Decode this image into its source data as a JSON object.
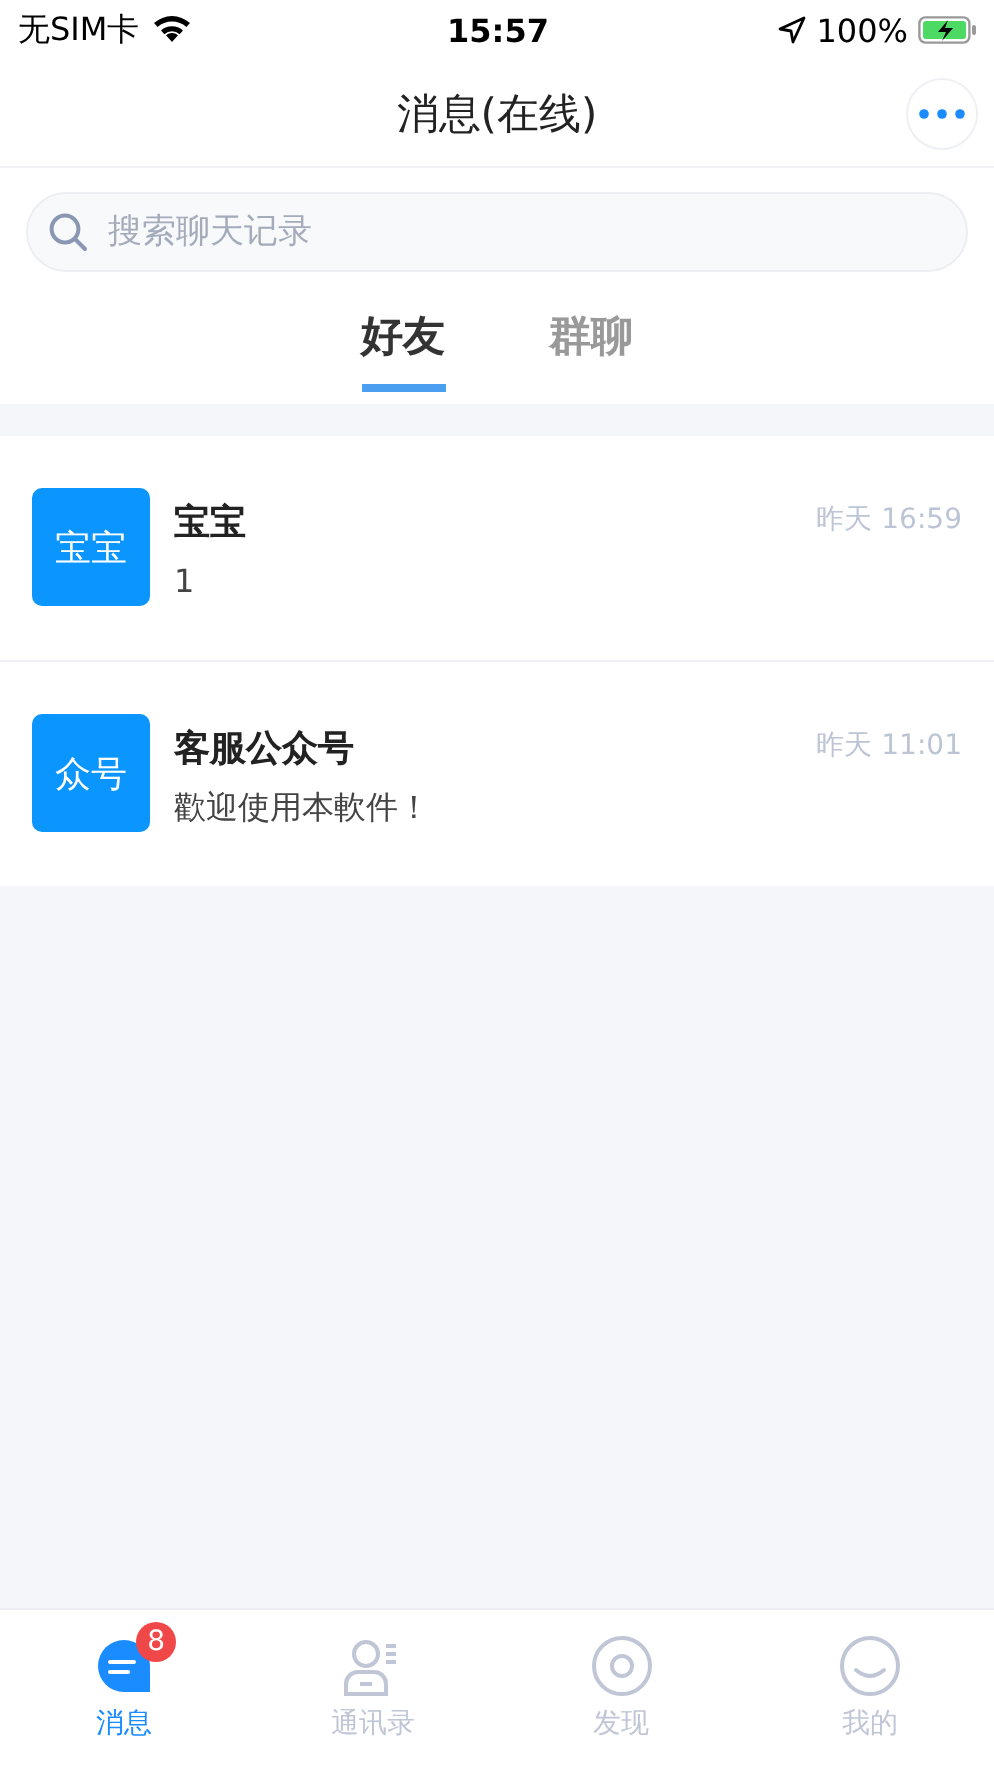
{
  "status_bar": {
    "carrier": "无SIM卡",
    "time": "15:57",
    "battery": "100%"
  },
  "header": {
    "title": "消息(在线)"
  },
  "search": {
    "placeholder": "搜索聊天记录"
  },
  "tabs": [
    {
      "label": "好友",
      "selected": true
    },
    {
      "label": "群聊",
      "selected": false
    }
  ],
  "conversations": [
    {
      "avatar": "宝宝",
      "name": "宝宝",
      "message": "1",
      "time": "昨天 16:59"
    },
    {
      "avatar": "众号",
      "name": "客服公众号",
      "message": "歡迎使用本軟件！",
      "time": "昨天 11:01"
    }
  ],
  "tab_bar": [
    {
      "kind": "chat",
      "label": "消息",
      "selected": true,
      "badge": "8"
    },
    {
      "kind": "contacts",
      "label": "通讯录",
      "selected": false
    },
    {
      "kind": "discover",
      "label": "发现",
      "selected": false
    },
    {
      "kind": "me",
      "label": "我的",
      "selected": false
    }
  ]
}
